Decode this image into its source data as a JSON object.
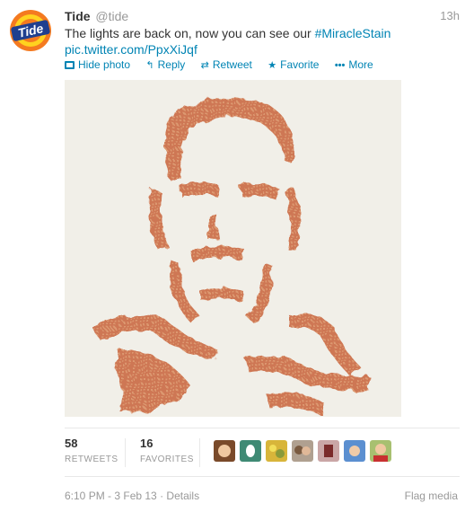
{
  "tweet": {
    "name": "Tide",
    "handle": "@tide",
    "time": "13h",
    "text_before": "The lights are back on, now you can see our ",
    "hashtag": "#MiracleStain",
    "link": "pic.twitter.com/PpxXiJqf",
    "avatar_logo": "Tide"
  },
  "actions": {
    "hide_photo": "Hide photo",
    "reply": "Reply",
    "retweet": "Retweet",
    "favorite": "Favorite",
    "more": "More"
  },
  "stats": {
    "retweets_count": "58",
    "retweets_label": "RETWEETS",
    "favorites_count": "16",
    "favorites_label": "FAVORITES"
  },
  "footer": {
    "timestamp": "6:10 PM - 3 Feb 13",
    "separator": " · ",
    "details": "Details",
    "flag": "Flag media"
  },
  "colors": {
    "link": "#0084b4",
    "stain": "#c8643a",
    "logo_orange": "#f47a20",
    "logo_blue": "#1f3f8f"
  }
}
